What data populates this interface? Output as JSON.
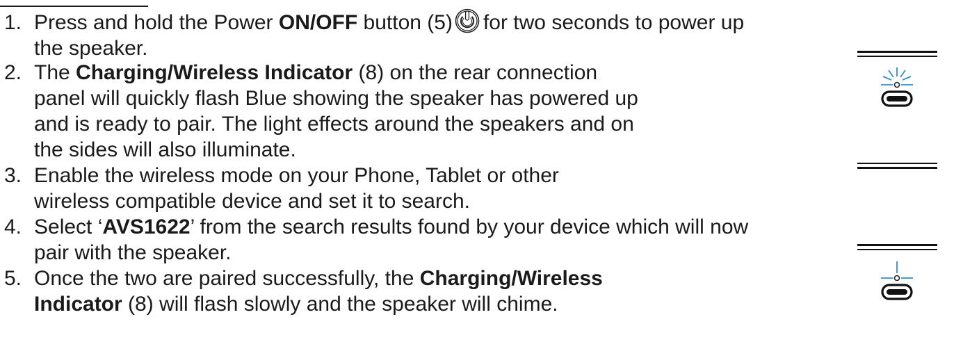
{
  "steps": [
    {
      "number": "1.",
      "line1_a": "Press and hold the Power ",
      "line1_bold": "ON/OFF",
      "line1_b": " button (5)",
      "line1_c": "for two seconds to power up",
      "line2": "the speaker."
    },
    {
      "number": "2.",
      "line1_a": "The ",
      "line1_bold": "Charging/Wireless Indicator",
      "line1_b": " (8) on the rear connection",
      "line2": "panel will quickly flash Blue showing the speaker has powered up",
      "line3": "and is ready to pair. The light effects around the speakers and on",
      "line4": "the sides will also illuminate."
    },
    {
      "number": "3.",
      "line1": "Enable the wireless mode on your Phone, Tablet or other",
      "line2": "wireless compatible device and set it to search."
    },
    {
      "number": "4.",
      "line1_a": "Select ‘",
      "line1_bold": "AVS1622",
      "line1_b": "’ from the search results found by your device which will now",
      "line2": "pair with the speaker."
    },
    {
      "number": "5.",
      "line1_a": "Once the two are paired successfully, the ",
      "line1_bold": "Charging/Wireless",
      "line2_bold": "Indicator",
      "line2_b": " (8) will flash slowly and the speaker will chime."
    }
  ],
  "colors": {
    "text": "#1a1a1a",
    "indicator_blue": "#2f8fd0"
  },
  "icons": {
    "power": "power-icon",
    "indicator_flash_fast": "charging-indicator-fast-flash-icon",
    "indicator_flash_slow": "charging-indicator-slow-flash-icon"
  }
}
